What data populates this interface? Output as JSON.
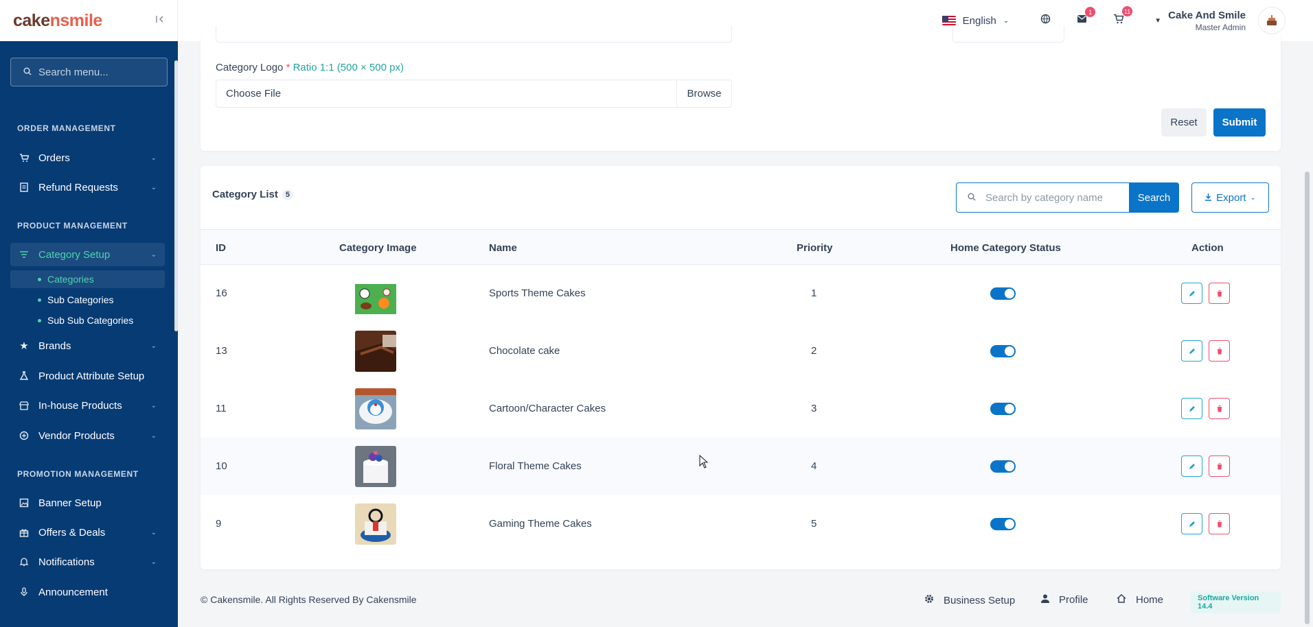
{
  "sidebar": {
    "logo_part1": "cake",
    "logo_part2": "nsmile",
    "search_placeholder": "Search menu...",
    "sections": {
      "order": "ORDER MANAGEMENT",
      "product": "PRODUCT MANAGEMENT",
      "promotion": "PROMOTION MANAGEMENT"
    },
    "items": {
      "orders": "Orders",
      "refund": "Refund Requests",
      "category_setup": "Category Setup",
      "categories": "Categories",
      "sub_categories": "Sub Categories",
      "sub_sub_categories": "Sub Sub Categories",
      "brands": "Brands",
      "attribute": "Product Attribute Setup",
      "inhouse": "In-house Products",
      "vendor": "Vendor Products",
      "banner": "Banner Setup",
      "offers": "Offers & Deals",
      "notifications": "Notifications",
      "announcement": "Announcement"
    }
  },
  "header": {
    "language": "English",
    "messages_badge": "1",
    "cart_badge": "11",
    "user_name": "Cake And Smile",
    "user_role": "Master Admin"
  },
  "form": {
    "logo_label": "Category Logo",
    "required_mark": "*",
    "ratio_hint": "Ratio 1:1 (500 × 500 px)",
    "file_placeholder": "Choose File",
    "browse": "Browse",
    "reset": "Reset",
    "submit": "Submit"
  },
  "list": {
    "title": "Category List",
    "count": "5",
    "search_placeholder": "Search by category name",
    "search_button": "Search",
    "export": "Export",
    "columns": [
      "ID",
      "Category Image",
      "Name",
      "Priority",
      "Home Category Status",
      "Action"
    ],
    "rows": [
      {
        "id": "16",
        "name": "Sports Theme Cakes",
        "priority": "1",
        "status": true
      },
      {
        "id": "13",
        "name": "Chocolate cake",
        "priority": "2",
        "status": true
      },
      {
        "id": "11",
        "name": "Cartoon/Character Cakes",
        "priority": "3",
        "status": true
      },
      {
        "id": "10",
        "name": "Floral Theme Cakes",
        "priority": "4",
        "status": true
      },
      {
        "id": "9",
        "name": "Gaming Theme Cakes",
        "priority": "5",
        "status": true
      }
    ]
  },
  "footer": {
    "copyright": "© Cakensmile. All Rights Reserved By Cakensmile",
    "business_setup": "Business Setup",
    "profile": "Profile",
    "home": "Home",
    "version": "Software Version 14.4"
  },
  "colors": {
    "sidebar_bg": "#073b74",
    "primary": "#0a74c9",
    "accent": "#4fd3b1",
    "danger": "#ef4d6d"
  }
}
